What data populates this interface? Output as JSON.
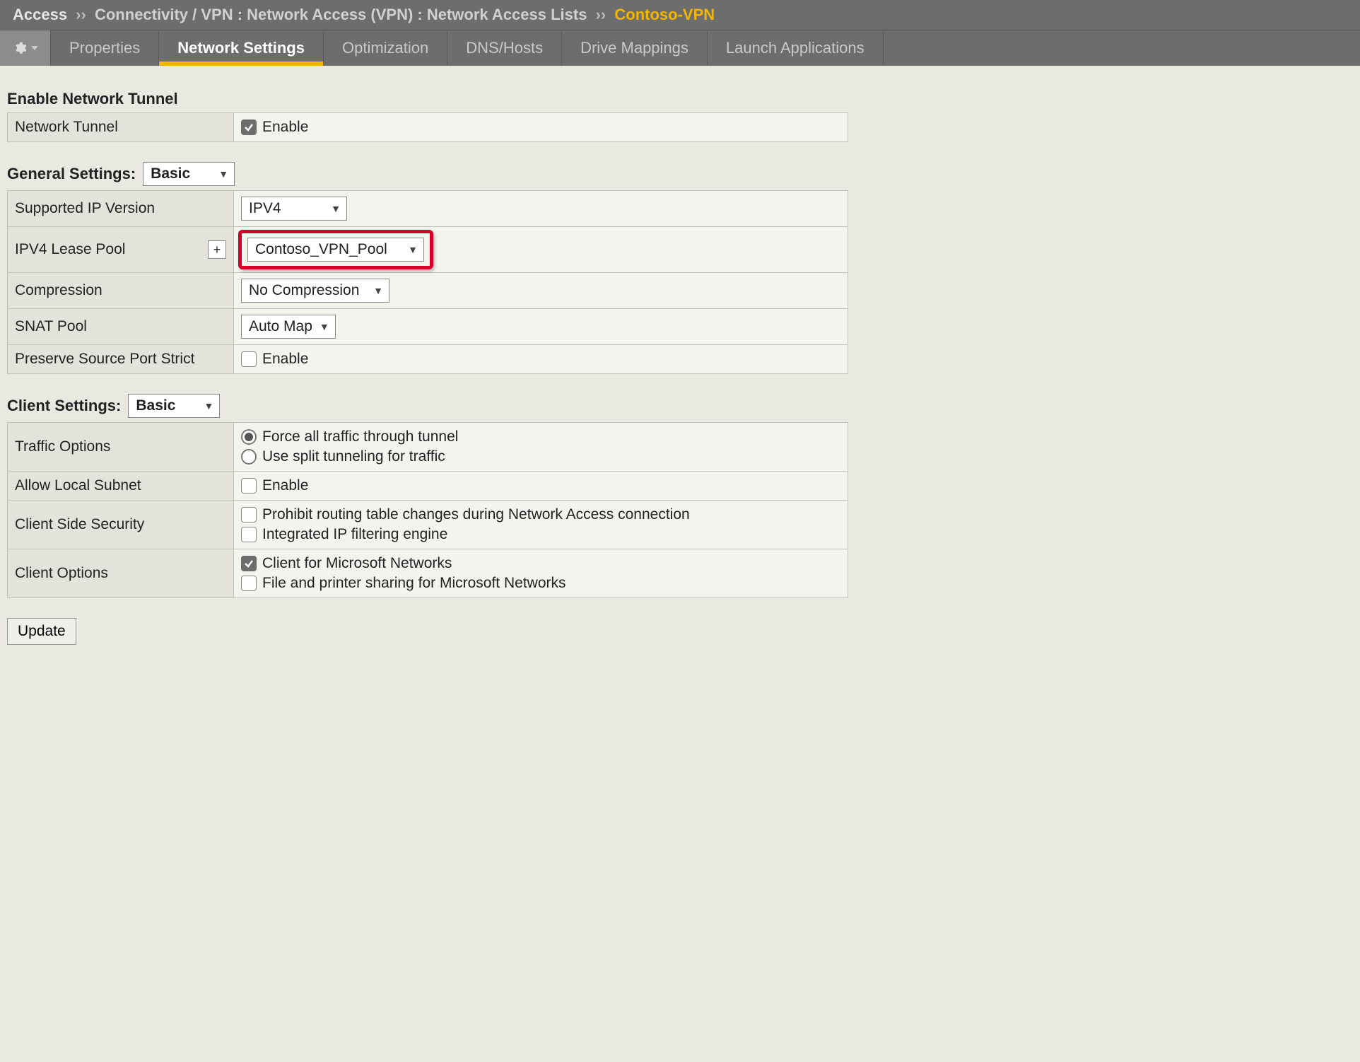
{
  "breadcrumb": {
    "root": "Access",
    "sep": "››",
    "path": "Connectivity / VPN : Network Access (VPN) : Network Access Lists",
    "current": "Contoso-VPN"
  },
  "tabs": {
    "properties": "Properties",
    "network_settings": "Network Settings",
    "optimization": "Optimization",
    "dns_hosts": "DNS/Hosts",
    "drive_mappings": "Drive Mappings",
    "launch_apps": "Launch Applications"
  },
  "sections": {
    "enable_tunnel_title": "Enable Network Tunnel",
    "general_settings_title": "General Settings:",
    "client_settings_title": "Client Settings:"
  },
  "selects": {
    "general_mode": "Basic",
    "client_mode": "Basic",
    "supported_ip": "IPV4",
    "lease_pool": "Contoso_VPN_Pool",
    "compression": "No Compression",
    "snat_pool": "Auto Map"
  },
  "rows": {
    "network_tunnel": "Network Tunnel",
    "supported_ip": "Supported IP Version",
    "lease_pool": "IPV4 Lease Pool",
    "compression": "Compression",
    "snat_pool": "SNAT Pool",
    "preserve_port": "Preserve Source Port Strict",
    "traffic_options": "Traffic Options",
    "allow_local_subnet": "Allow Local Subnet",
    "client_side_security": "Client Side Security",
    "client_options": "Client Options"
  },
  "labels": {
    "enable": "Enable",
    "plus": "+",
    "traffic_force": "Force all traffic through tunnel",
    "traffic_split": "Use split tunneling for traffic",
    "prohibit_routing": "Prohibit routing table changes during Network Access connection",
    "integrated_filter": "Integrated IP filtering engine",
    "client_ms": "Client for Microsoft Networks",
    "file_printer": "File and printer sharing for Microsoft Networks"
  },
  "buttons": {
    "update": "Update"
  }
}
